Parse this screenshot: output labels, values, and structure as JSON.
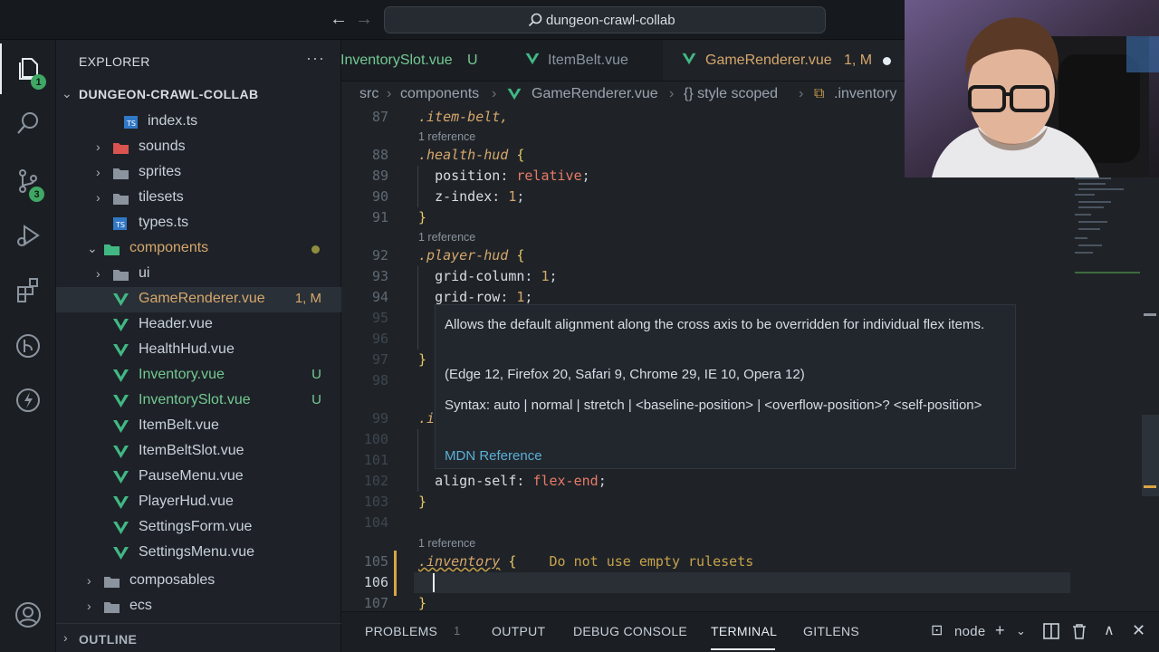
{
  "titlebar": {
    "back_icon": "arrow-left-icon",
    "forward_icon": "arrow-right-icon",
    "command_center": "dungeon-crawl-collab"
  },
  "activity_bar": {
    "items": [
      {
        "name": "explorer-icon",
        "badge": "1"
      },
      {
        "name": "search-icon"
      },
      {
        "name": "source-control-icon",
        "badge": "3"
      },
      {
        "name": "run-debug-icon"
      },
      {
        "name": "extensions-icon"
      },
      {
        "name": "git-graph-icon"
      },
      {
        "name": "lightning-icon"
      },
      {
        "name": "account-icon"
      }
    ]
  },
  "sidebar": {
    "title": "EXPLORER",
    "more": "···",
    "root": "DUNGEON-CRAWL-COLLAB",
    "items": [
      {
        "label": "index.ts",
        "type": "ts"
      },
      {
        "label": "sounds",
        "type": "folder-red"
      },
      {
        "label": "sprites",
        "type": "folder"
      },
      {
        "label": "tilesets",
        "type": "folder"
      },
      {
        "label": "types.ts",
        "type": "ts"
      },
      {
        "label": "components",
        "type": "folder-open"
      },
      {
        "label": "ui",
        "type": "folder"
      },
      {
        "label": "GameRenderer.vue",
        "status": "1, M"
      },
      {
        "label": "Header.vue"
      },
      {
        "label": "HealthHud.vue"
      },
      {
        "label": "Inventory.vue",
        "status": "U"
      },
      {
        "label": "InventorySlot.vue",
        "status": "U"
      },
      {
        "label": "ItemBelt.vue"
      },
      {
        "label": "ItemBeltSlot.vue"
      },
      {
        "label": "PauseMenu.vue"
      },
      {
        "label": "PlayerHud.vue"
      },
      {
        "label": "SettingsForm.vue"
      },
      {
        "label": "SettingsMenu.vue"
      },
      {
        "label": "composables",
        "type": "folder"
      },
      {
        "label": "ecs",
        "type": "folder"
      }
    ],
    "outline": "OUTLINE"
  },
  "tabs": [
    {
      "label": "InventorySlot.vue",
      "status": "U"
    },
    {
      "label": "ItemBelt.vue",
      "status": ""
    },
    {
      "label": "GameRenderer.vue",
      "status": "1, M"
    }
  ],
  "breadcrumb": {
    "parts": [
      "src",
      "components",
      "GameRenderer.vue",
      "{} style scoped",
      ".inventory"
    ]
  },
  "editor": {
    "reference_lens": "1 reference",
    "lines": [
      {
        "n": "87",
        "code": ".item-belt,"
      },
      {
        "n": "88",
        "code": ".health-hud {"
      },
      {
        "n": "89",
        "code": "position: relative;"
      },
      {
        "n": "90",
        "code": "z-index: 1;"
      },
      {
        "n": "91",
        "code": "}"
      },
      {
        "n": "92",
        "code": ".player-hud {"
      },
      {
        "n": "93",
        "code": "grid-column: 1;"
      },
      {
        "n": "94",
        "code": "grid-row: 1;"
      },
      {
        "n": "95",
        "code": ""
      },
      {
        "n": "96",
        "code": ""
      },
      {
        "n": "97",
        "code": "}"
      },
      {
        "n": "98",
        "code": ""
      },
      {
        "n": "99",
        "code": ".i"
      },
      {
        "n": "100",
        "code": ""
      },
      {
        "n": "101",
        "code": ""
      },
      {
        "n": "102",
        "code": "align-self: flex-end;"
      },
      {
        "n": "103",
        "code": "}"
      },
      {
        "n": "104",
        "code": ""
      },
      {
        "n": "105",
        "code": ".inventory {"
      },
      {
        "n": "106",
        "code": ""
      },
      {
        "n": "107",
        "code": "}"
      }
    ],
    "lint_warning": "Do not use empty rulesets",
    "hover": {
      "description": "Allows the default alignment along the cross axis to be overridden for individual flex items.",
      "compat": "(Edge 12, Firefox 20, Safari 9, Chrome 29, IE 10, Opera 12)",
      "syntax": "Syntax: auto | normal | stretch | <baseline-position> | <overflow-position>? <self-position>",
      "link": "MDN Reference"
    }
  },
  "panel": {
    "tabs": [
      "PROBLEMS",
      "OUTPUT",
      "DEBUG CONSOLE",
      "TERMINAL",
      "GITLENS"
    ],
    "problems_count": "1",
    "active": "TERMINAL",
    "terminal_name": "node"
  },
  "colors": {
    "accent_green": "#3fa865",
    "vue_green": "#41b883",
    "modified": "#d6a76b",
    "untracked": "#73c991"
  }
}
